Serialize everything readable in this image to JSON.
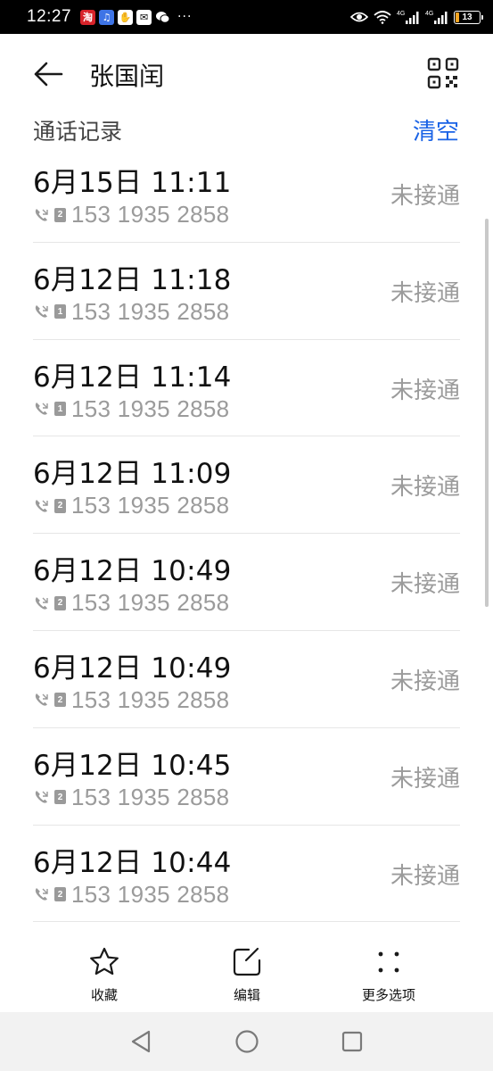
{
  "status_bar": {
    "time": "12:27",
    "icons": [
      "taobao-icon",
      "music-icon",
      "hand-icon",
      "mail-icon",
      "wechat-icon"
    ],
    "more": "···",
    "battery": "13",
    "network_labels": [
      "4G",
      "4G"
    ]
  },
  "header": {
    "contact_name": "张国闰"
  },
  "section": {
    "title": "通话记录",
    "clear_label": "清空"
  },
  "calls": [
    {
      "time": "6月15日 11:11",
      "sim": "2",
      "number": "153 1935 2858",
      "status": "未接通"
    },
    {
      "time": "6月12日 11:18",
      "sim": "1",
      "number": "153 1935 2858",
      "status": "未接通"
    },
    {
      "time": "6月12日 11:14",
      "sim": "1",
      "number": "153 1935 2858",
      "status": "未接通"
    },
    {
      "time": "6月12日 11:09",
      "sim": "2",
      "number": "153 1935 2858",
      "status": "未接通"
    },
    {
      "time": "6月12日 10:49",
      "sim": "2",
      "number": "153 1935 2858",
      "status": "未接通"
    },
    {
      "time": "6月12日 10:49",
      "sim": "2",
      "number": "153 1935 2858",
      "status": "未接通"
    },
    {
      "time": "6月12日 10:45",
      "sim": "2",
      "number": "153 1935 2858",
      "status": "未接通"
    },
    {
      "time": "6月12日 10:44",
      "sim": "2",
      "number": "153 1935 2858",
      "status": "未接通"
    }
  ],
  "actions": {
    "favorite_label": "收藏",
    "edit_label": "编辑",
    "more_label": "更多选项"
  },
  "colors": {
    "accent": "#1a63e6",
    "secondary_text": "#9b9b9b"
  }
}
